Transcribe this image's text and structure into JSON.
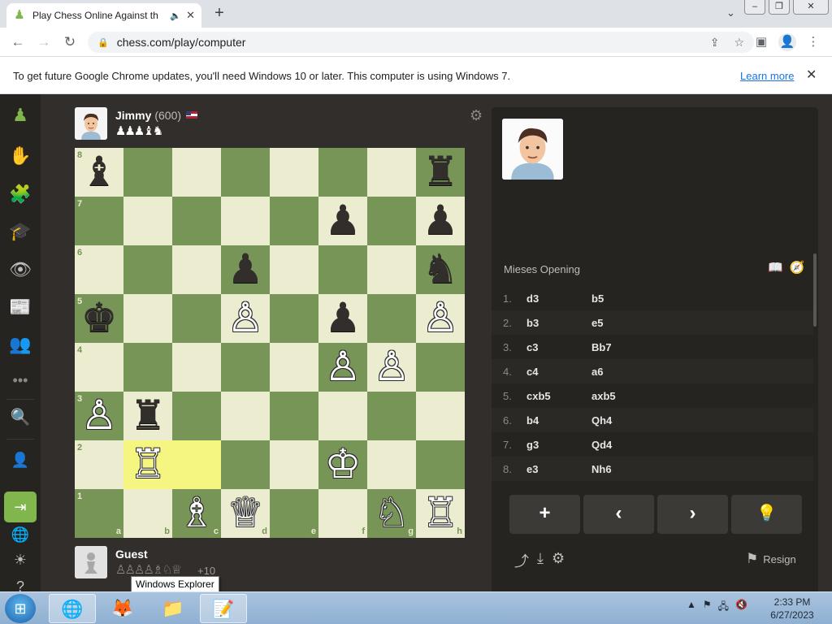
{
  "browser": {
    "tab_title": "Play Chess Online Against th",
    "url": "chess.com/play/computer",
    "infobar_message": "To get future Google Chrome updates, you'll need Windows 10 or later. This computer is using Windows 7.",
    "infobar_link": "Learn more"
  },
  "sidebar": {
    "items": [
      "pawn-logo",
      "play-hand",
      "puzzles",
      "learn-cap",
      "watch-binoculars",
      "news",
      "social",
      "more"
    ]
  },
  "top_player": {
    "name": "Jimmy",
    "rating": "(600)",
    "captured": "♟♟♟♝♞"
  },
  "bottom_player": {
    "name": "Guest",
    "captured": "♙♙♙♙♗♘♕",
    "advantage": "+10"
  },
  "board": {
    "ranks": [
      "8",
      "7",
      "6",
      "5",
      "4",
      "3",
      "2",
      "1"
    ],
    "files": [
      "a",
      "b",
      "c",
      "d",
      "e",
      "f",
      "g",
      "h"
    ],
    "highlight": [
      "b2",
      "c2"
    ],
    "pieces": [
      {
        "sq": "a8",
        "p": "♝",
        "c": "b"
      },
      {
        "sq": "h8",
        "p": "♜",
        "c": "b"
      },
      {
        "sq": "f7",
        "p": "♟",
        "c": "b"
      },
      {
        "sq": "h7",
        "p": "♟",
        "c": "b"
      },
      {
        "sq": "d6",
        "p": "♟",
        "c": "b"
      },
      {
        "sq": "h6",
        "p": "♞",
        "c": "b"
      },
      {
        "sq": "a5",
        "p": "♚",
        "c": "b"
      },
      {
        "sq": "d5",
        "p": "♙",
        "c": "w"
      },
      {
        "sq": "f5",
        "p": "♟",
        "c": "b"
      },
      {
        "sq": "h5",
        "p": "♙",
        "c": "w"
      },
      {
        "sq": "f4",
        "p": "♙",
        "c": "w"
      },
      {
        "sq": "g4",
        "p": "♙",
        "c": "w"
      },
      {
        "sq": "a3",
        "p": "♙",
        "c": "w"
      },
      {
        "sq": "b3",
        "p": "♜",
        "c": "b"
      },
      {
        "sq": "b2",
        "p": "♖",
        "c": "w"
      },
      {
        "sq": "f2",
        "p": "♔",
        "c": "w"
      },
      {
        "sq": "c1",
        "p": "♗",
        "c": "w"
      },
      {
        "sq": "d1",
        "p": "♕",
        "c": "w"
      },
      {
        "sq": "g1",
        "p": "♘",
        "c": "w"
      },
      {
        "sq": "h1",
        "p": "♖",
        "c": "w"
      }
    ],
    "colors": {
      "light": "#ebecd0",
      "dark": "#779556",
      "highlight": "#f5f682"
    }
  },
  "panel": {
    "opening": "Mieses Opening",
    "moves": [
      {
        "n": "1.",
        "w": "d3",
        "b": "b5"
      },
      {
        "n": "2.",
        "w": "b3",
        "b": "e5"
      },
      {
        "n": "3.",
        "w": "c3",
        "b": "Bb7"
      },
      {
        "n": "4.",
        "w": "c4",
        "b": "a6"
      },
      {
        "n": "5.",
        "w": "cxb5",
        "b": "axb5"
      },
      {
        "n": "6.",
        "w": "b4",
        "b": "Qh4"
      },
      {
        "n": "7.",
        "w": "g3",
        "b": "Qd4"
      },
      {
        "n": "8.",
        "w": "e3",
        "b": "Nh6"
      }
    ],
    "controls": [
      "+",
      "‹",
      "›",
      "💡"
    ],
    "resign": "Resign"
  },
  "tooltip": "Windows Explorer",
  "taskbar": {
    "time": "2:33 PM",
    "date": "6/27/2023"
  }
}
